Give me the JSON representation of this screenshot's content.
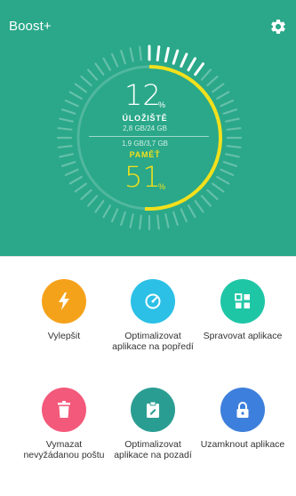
{
  "header": {
    "title": "Boost+",
    "settings_icon": "gear-icon"
  },
  "gauge": {
    "storage": {
      "percent": "12",
      "percent_sign": "%",
      "label": "ÚLOŽIŠTĚ",
      "detail": "2,8 GB/24 GB",
      "level": 0.12,
      "color": "#ffffff"
    },
    "memory": {
      "percent": "51",
      "percent_sign": "%",
      "label": "PAMĚŤ",
      "detail": "1,9 GB/3,7 GB",
      "level": 0.51,
      "color": "#f2e01c"
    }
  },
  "colors": {
    "panel": "#2aa889",
    "memory_accent": "#f2e01c",
    "boost": "#f5a21b",
    "foreground": "#2cc0e6",
    "manage": "#1fc6a6",
    "junk": "#f3597a",
    "background": "#2a9d92",
    "lock": "#3d7fdc"
  },
  "actions": [
    {
      "label": "Vylepšit",
      "icon": "lightning-bolt-icon"
    },
    {
      "label": "Optimalizovat aplikace na popředí",
      "icon": "speedometer-icon"
    },
    {
      "label": "Spravovat aplikace",
      "icon": "app-grid-icon"
    },
    {
      "label": "Vymazat nevyžádanou poštu",
      "icon": "trash-icon"
    },
    {
      "label": "Optimalizovat aplikace na pozadí",
      "icon": "clipboard-edit-icon"
    },
    {
      "label": "Uzamknout aplikace",
      "icon": "lock-icon"
    }
  ]
}
